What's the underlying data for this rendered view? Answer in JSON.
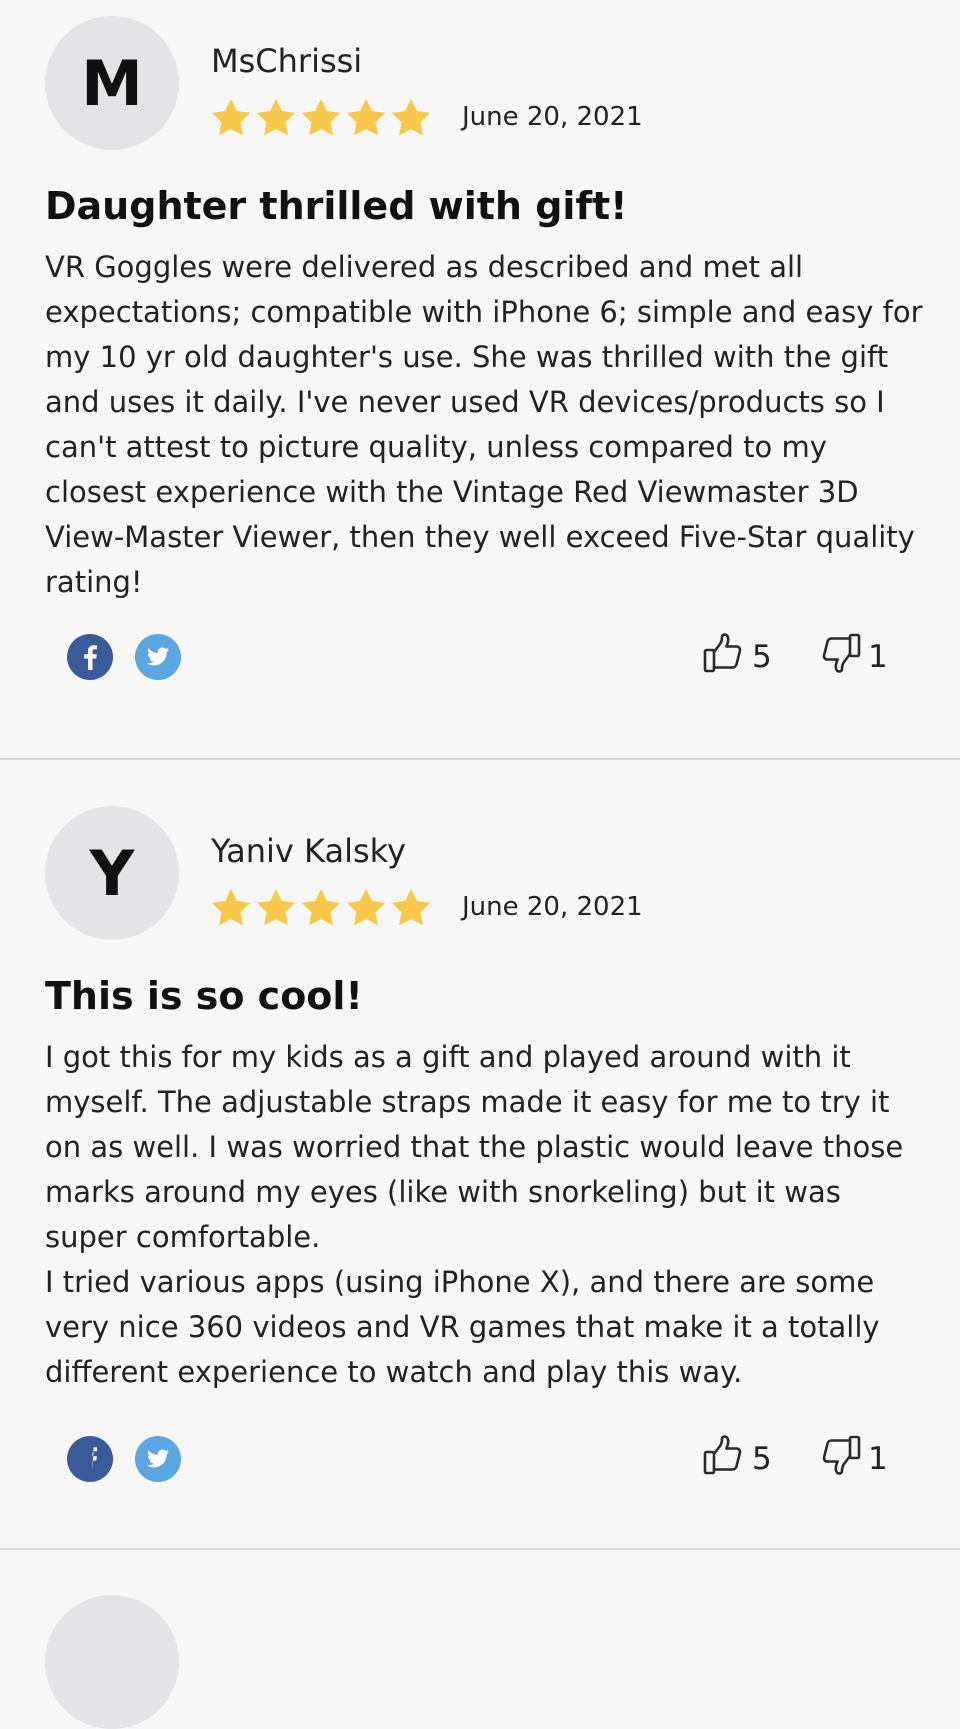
{
  "reviews": [
    {
      "avatar_letter": "M",
      "author": "MsChrissi",
      "rating": 5,
      "rating_max": 5,
      "date": "June 20, 2021",
      "title": "Daughter thrilled with gift!",
      "body": "VR Goggles were delivered as described and met all expectations; compatible with iPhone 6; simple and easy for my 10 yr old daughter's use. She was thrilled with the gift and uses it daily. I've never used VR devices/products so I can't attest to picture quality, unless compared to my closest experience with the Vintage Red Viewmaster 3D View-Master Viewer, then they well exceed Five-Star quality rating!",
      "helpful_yes": "5",
      "helpful_no": "1"
    },
    {
      "avatar_letter": "Y",
      "author": "Yaniv Kalsky",
      "rating": 5,
      "rating_max": 5,
      "date": "June 20, 2021",
      "title": "This is so cool!",
      "body": "I got this for my kids as a gift and played around with it myself. The adjustable straps made it easy for me to try it on as well. I was worried that the plastic would leave those marks around my eyes (like with snorkeling) but it was super comfortable.\nI tried various apps (using iPhone X), and there are some very nice 360 videos and VR games that make it a totally different experience to watch and play this way.",
      "helpful_yes": "5",
      "helpful_no": "1"
    }
  ],
  "icons": {
    "star": "star-icon",
    "facebook": "facebook-icon",
    "twitter": "twitter-icon",
    "thumbs_up": "thumbs-up-icon",
    "thumbs_down": "thumbs-down-icon"
  },
  "colors": {
    "star": "#f7c84a",
    "facebook": "#3b5a9a",
    "twitter": "#5aa7e2",
    "avatar_bg": "#e4e4e6",
    "background": "#f7f7f8"
  }
}
